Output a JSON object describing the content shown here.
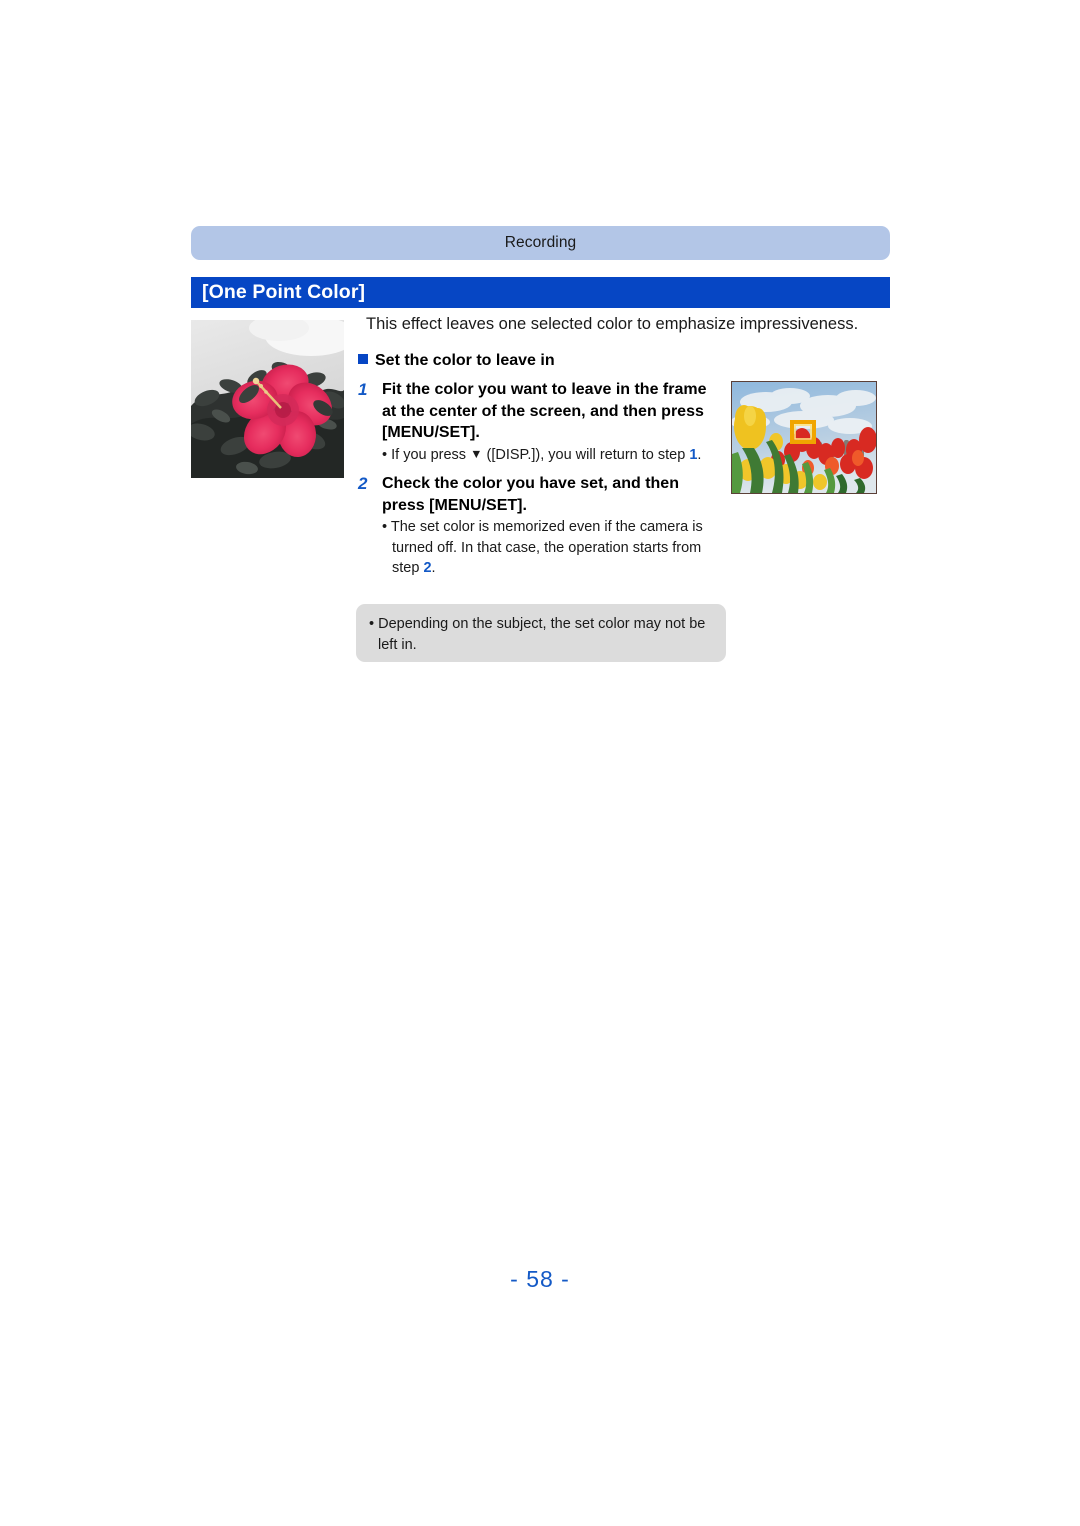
{
  "header": {
    "running_head": "Recording"
  },
  "section": {
    "title": "[One Point Color]",
    "intro": "This effect leaves one selected color to emphasize impressiveness."
  },
  "instructions": {
    "sub_heading": "Set the color to leave in",
    "steps": [
      {
        "number": "1",
        "title": "Fit the color you want to leave in the frame at the center of the screen, and then press [MENU/SET].",
        "note_pre": "• If you press ",
        "note_triangle": "▼",
        "note_mid": " ([DISP.]), you will return to step ",
        "note_ref": "1",
        "note_post": "."
      },
      {
        "number": "2",
        "title": "Check the color you have set, and then press [MENU/SET].",
        "note_pre": "• The set color is memorized even if the camera is turned off. In that case, the operation starts from step ",
        "note_ref": "2",
        "note_post": "."
      }
    ]
  },
  "note_box": {
    "text": "• Depending on the subject, the set color may not be left in."
  },
  "footer": {
    "page_number": "- 58 -"
  },
  "colors": {
    "header_bar": "#b3c6e7",
    "title_bar": "#0646c4",
    "accent_blue": "#1359c6",
    "note_box_bg": "#dcdcdc",
    "page_number": "#1359c6"
  },
  "images": {
    "left_photo": "hibiscus-partial-color-photo",
    "right_photo": "tulips-af-frame-photo"
  }
}
